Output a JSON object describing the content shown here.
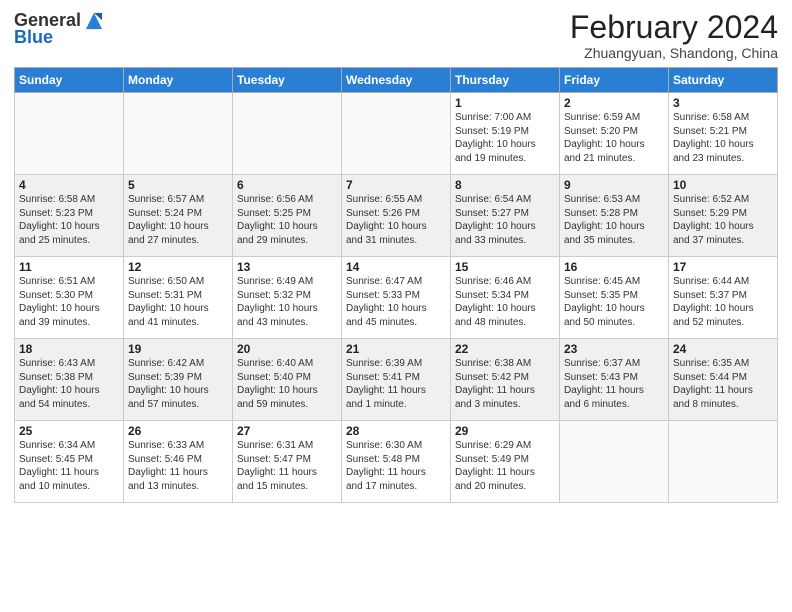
{
  "header": {
    "logo_general": "General",
    "logo_blue": "Blue",
    "month_title": "February 2024",
    "location": "Zhuangyuan, Shandong, China"
  },
  "days_of_week": [
    "Sunday",
    "Monday",
    "Tuesday",
    "Wednesday",
    "Thursday",
    "Friday",
    "Saturday"
  ],
  "weeks": [
    [
      {
        "day": "",
        "info": ""
      },
      {
        "day": "",
        "info": ""
      },
      {
        "day": "",
        "info": ""
      },
      {
        "day": "",
        "info": ""
      },
      {
        "day": "1",
        "info": "Sunrise: 7:00 AM\nSunset: 5:19 PM\nDaylight: 10 hours\nand 19 minutes."
      },
      {
        "day": "2",
        "info": "Sunrise: 6:59 AM\nSunset: 5:20 PM\nDaylight: 10 hours\nand 21 minutes."
      },
      {
        "day": "3",
        "info": "Sunrise: 6:58 AM\nSunset: 5:21 PM\nDaylight: 10 hours\nand 23 minutes."
      }
    ],
    [
      {
        "day": "4",
        "info": "Sunrise: 6:58 AM\nSunset: 5:23 PM\nDaylight: 10 hours\nand 25 minutes."
      },
      {
        "day": "5",
        "info": "Sunrise: 6:57 AM\nSunset: 5:24 PM\nDaylight: 10 hours\nand 27 minutes."
      },
      {
        "day": "6",
        "info": "Sunrise: 6:56 AM\nSunset: 5:25 PM\nDaylight: 10 hours\nand 29 minutes."
      },
      {
        "day": "7",
        "info": "Sunrise: 6:55 AM\nSunset: 5:26 PM\nDaylight: 10 hours\nand 31 minutes."
      },
      {
        "day": "8",
        "info": "Sunrise: 6:54 AM\nSunset: 5:27 PM\nDaylight: 10 hours\nand 33 minutes."
      },
      {
        "day": "9",
        "info": "Sunrise: 6:53 AM\nSunset: 5:28 PM\nDaylight: 10 hours\nand 35 minutes."
      },
      {
        "day": "10",
        "info": "Sunrise: 6:52 AM\nSunset: 5:29 PM\nDaylight: 10 hours\nand 37 minutes."
      }
    ],
    [
      {
        "day": "11",
        "info": "Sunrise: 6:51 AM\nSunset: 5:30 PM\nDaylight: 10 hours\nand 39 minutes."
      },
      {
        "day": "12",
        "info": "Sunrise: 6:50 AM\nSunset: 5:31 PM\nDaylight: 10 hours\nand 41 minutes."
      },
      {
        "day": "13",
        "info": "Sunrise: 6:49 AM\nSunset: 5:32 PM\nDaylight: 10 hours\nand 43 minutes."
      },
      {
        "day": "14",
        "info": "Sunrise: 6:47 AM\nSunset: 5:33 PM\nDaylight: 10 hours\nand 45 minutes."
      },
      {
        "day": "15",
        "info": "Sunrise: 6:46 AM\nSunset: 5:34 PM\nDaylight: 10 hours\nand 48 minutes."
      },
      {
        "day": "16",
        "info": "Sunrise: 6:45 AM\nSunset: 5:35 PM\nDaylight: 10 hours\nand 50 minutes."
      },
      {
        "day": "17",
        "info": "Sunrise: 6:44 AM\nSunset: 5:37 PM\nDaylight: 10 hours\nand 52 minutes."
      }
    ],
    [
      {
        "day": "18",
        "info": "Sunrise: 6:43 AM\nSunset: 5:38 PM\nDaylight: 10 hours\nand 54 minutes."
      },
      {
        "day": "19",
        "info": "Sunrise: 6:42 AM\nSunset: 5:39 PM\nDaylight: 10 hours\nand 57 minutes."
      },
      {
        "day": "20",
        "info": "Sunrise: 6:40 AM\nSunset: 5:40 PM\nDaylight: 10 hours\nand 59 minutes."
      },
      {
        "day": "21",
        "info": "Sunrise: 6:39 AM\nSunset: 5:41 PM\nDaylight: 11 hours\nand 1 minute."
      },
      {
        "day": "22",
        "info": "Sunrise: 6:38 AM\nSunset: 5:42 PM\nDaylight: 11 hours\nand 3 minutes."
      },
      {
        "day": "23",
        "info": "Sunrise: 6:37 AM\nSunset: 5:43 PM\nDaylight: 11 hours\nand 6 minutes."
      },
      {
        "day": "24",
        "info": "Sunrise: 6:35 AM\nSunset: 5:44 PM\nDaylight: 11 hours\nand 8 minutes."
      }
    ],
    [
      {
        "day": "25",
        "info": "Sunrise: 6:34 AM\nSunset: 5:45 PM\nDaylight: 11 hours\nand 10 minutes."
      },
      {
        "day": "26",
        "info": "Sunrise: 6:33 AM\nSunset: 5:46 PM\nDaylight: 11 hours\nand 13 minutes."
      },
      {
        "day": "27",
        "info": "Sunrise: 6:31 AM\nSunset: 5:47 PM\nDaylight: 11 hours\nand 15 minutes."
      },
      {
        "day": "28",
        "info": "Sunrise: 6:30 AM\nSunset: 5:48 PM\nDaylight: 11 hours\nand 17 minutes."
      },
      {
        "day": "29",
        "info": "Sunrise: 6:29 AM\nSunset: 5:49 PM\nDaylight: 11 hours\nand 20 minutes."
      },
      {
        "day": "",
        "info": ""
      },
      {
        "day": "",
        "info": ""
      }
    ]
  ]
}
